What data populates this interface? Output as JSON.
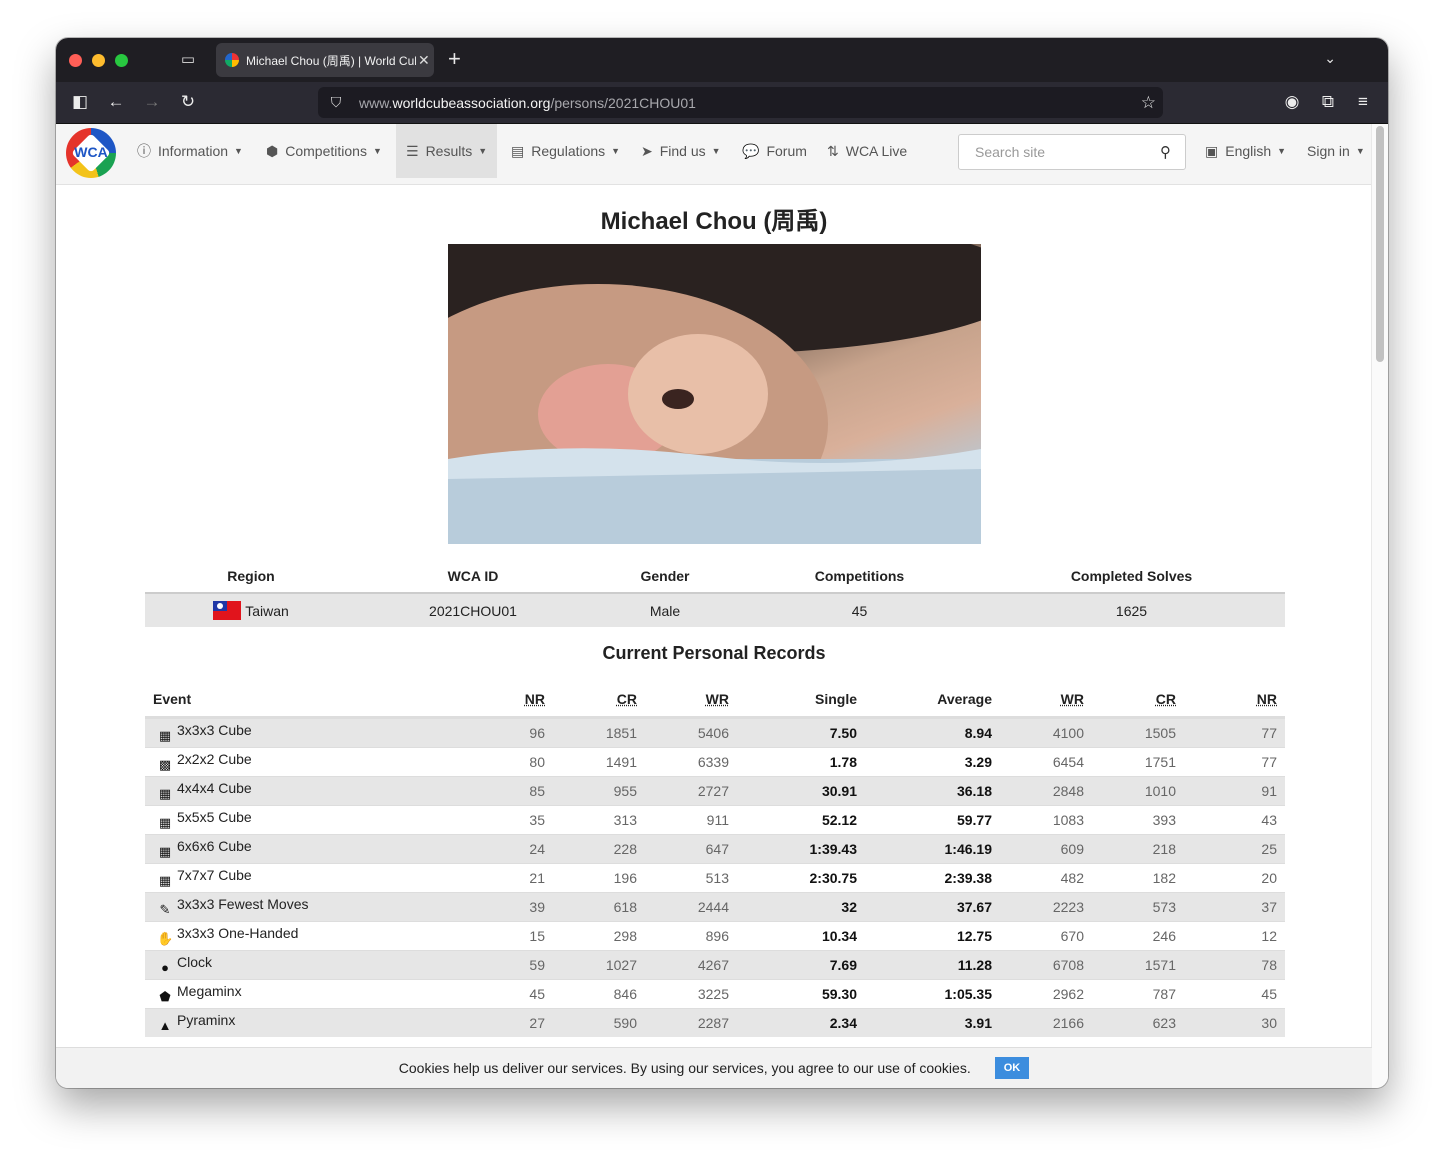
{
  "browser": {
    "tab_title": "Michael Chou (周禹) | World Cub",
    "url_prefix": "www.",
    "url_domain": "worldcubeassociation.org",
    "url_path": "/persons/2021CHOU01"
  },
  "nav": {
    "items": [
      {
        "label": "Information",
        "icon": "info-icon"
      },
      {
        "label": "Competitions",
        "icon": "cube-icon"
      },
      {
        "label": "Results",
        "icon": "list-icon"
      },
      {
        "label": "Regulations",
        "icon": "book-icon"
      },
      {
        "label": "Find us",
        "icon": "send-icon"
      },
      {
        "label": "Forum",
        "icon": "comments-icon"
      },
      {
        "label": "WCA Live",
        "icon": "sort-icon"
      }
    ],
    "search_placeholder": "Search site",
    "language": "English",
    "sign_in": "Sign in"
  },
  "person": {
    "name": "Michael Chou (周禹)",
    "headers": {
      "region": "Region",
      "wca_id": "WCA ID",
      "gender": "Gender",
      "competitions": "Competitions",
      "completed_solves": "Completed Solves"
    },
    "region": "Taiwan",
    "wca_id": "2021CHOU01",
    "gender": "Male",
    "competitions": "45",
    "completed_solves": "1625"
  },
  "records": {
    "title": "Current Personal Records",
    "headers": {
      "event": "Event",
      "nr": "NR",
      "cr": "CR",
      "wr": "WR",
      "single": "Single",
      "average": "Average",
      "wr2": "WR",
      "cr2": "CR",
      "nr2": "NR"
    },
    "rows": [
      {
        "event": "3x3x3 Cube",
        "icon": "333-icon",
        "nr": "96",
        "cr": "1851",
        "wr": "5406",
        "single": "7.50",
        "average": "8.94",
        "wr2": "4100",
        "cr2": "1505",
        "nr2": "77"
      },
      {
        "event": "2x2x2 Cube",
        "icon": "222-icon",
        "nr": "80",
        "cr": "1491",
        "wr": "6339",
        "single": "1.78",
        "average": "3.29",
        "wr2": "6454",
        "cr2": "1751",
        "nr2": "77"
      },
      {
        "event": "4x4x4 Cube",
        "icon": "444-icon",
        "nr": "85",
        "cr": "955",
        "wr": "2727",
        "single": "30.91",
        "average": "36.18",
        "wr2": "2848",
        "cr2": "1010",
        "nr2": "91"
      },
      {
        "event": "5x5x5 Cube",
        "icon": "555-icon",
        "nr": "35",
        "cr": "313",
        "wr": "911",
        "single": "52.12",
        "average": "59.77",
        "wr2": "1083",
        "cr2": "393",
        "nr2": "43"
      },
      {
        "event": "6x6x6 Cube",
        "icon": "666-icon",
        "nr": "24",
        "cr": "228",
        "wr": "647",
        "single": "1:39.43",
        "average": "1:46.19",
        "wr2": "609",
        "cr2": "218",
        "nr2": "25"
      },
      {
        "event": "7x7x7 Cube",
        "icon": "777-icon",
        "nr": "21",
        "cr": "196",
        "wr": "513",
        "single": "2:30.75",
        "average": "2:39.38",
        "wr2": "482",
        "cr2": "182",
        "nr2": "20"
      },
      {
        "event": "3x3x3 Fewest Moves",
        "icon": "fmc-icon",
        "nr": "39",
        "cr": "618",
        "wr": "2444",
        "single": "32",
        "average": "37.67",
        "wr2": "2223",
        "cr2": "573",
        "nr2": "37"
      },
      {
        "event": "3x3x3 One-Handed",
        "icon": "oh-icon",
        "nr": "15",
        "cr": "298",
        "wr": "896",
        "single": "10.34",
        "average": "12.75",
        "wr2": "670",
        "cr2": "246",
        "nr2": "12"
      },
      {
        "event": "Clock",
        "icon": "clock-icon",
        "nr": "59",
        "cr": "1027",
        "wr": "4267",
        "single": "7.69",
        "average": "11.28",
        "wr2": "6708",
        "cr2": "1571",
        "nr2": "78"
      },
      {
        "event": "Megaminx",
        "icon": "megaminx-icon",
        "nr": "45",
        "cr": "846",
        "wr": "3225",
        "single": "59.30",
        "average": "1:05.35",
        "wr2": "2962",
        "cr2": "787",
        "nr2": "45"
      },
      {
        "event": "Pyraminx",
        "icon": "pyraminx-icon",
        "nr": "27",
        "cr": "590",
        "wr": "2287",
        "single": "2.34",
        "average": "3.91",
        "wr2": "2166",
        "cr2": "623",
        "nr2": "30"
      }
    ]
  },
  "cookie": {
    "text": "Cookies help us deliver our services. By using our services, you agree to our use of cookies.",
    "ok": "OK"
  }
}
